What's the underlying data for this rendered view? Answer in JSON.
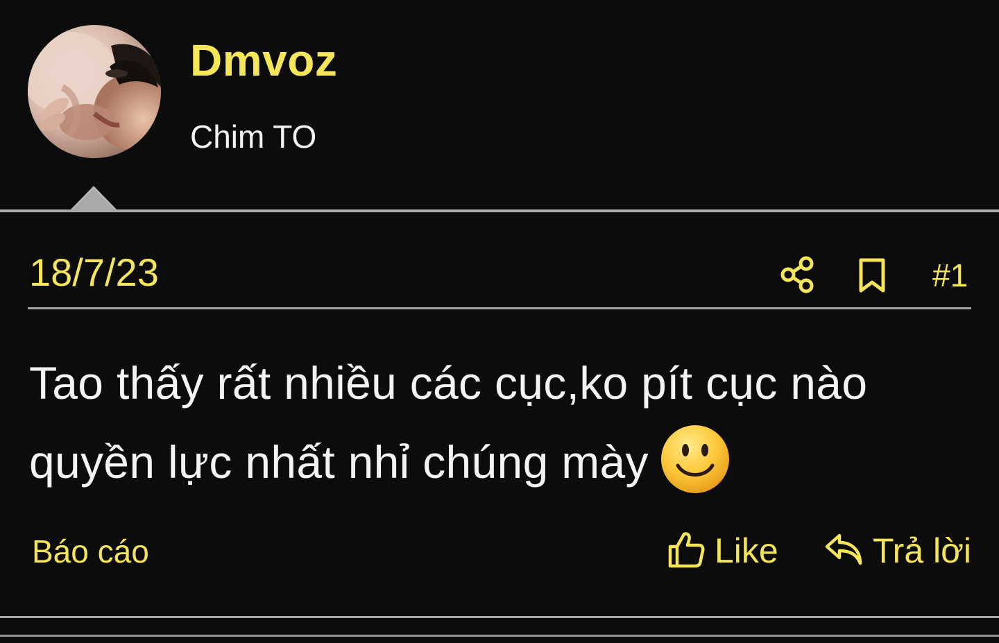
{
  "user": {
    "name": "Dmvoz",
    "title": "Chim TO"
  },
  "post": {
    "date": "18/7/23",
    "number": "#1",
    "message": "Tao thấy rất nhiều các cục,ko pít cục nào quyền lực nhất nhỉ chúng mày",
    "emoji": "smile-icon"
  },
  "actions": {
    "report_label": "Báo cáo",
    "like_label": "Like",
    "reply_label": "Trả lời"
  },
  "colors": {
    "background": "#0c0c0c",
    "accent": "#f4e55a",
    "text": "#f2f2f2",
    "divider": "#a9a9a9"
  },
  "icons": [
    "share-icon",
    "bookmark-icon",
    "thumbs-up-icon",
    "reply-arrow-icon",
    "smile-icon"
  ]
}
